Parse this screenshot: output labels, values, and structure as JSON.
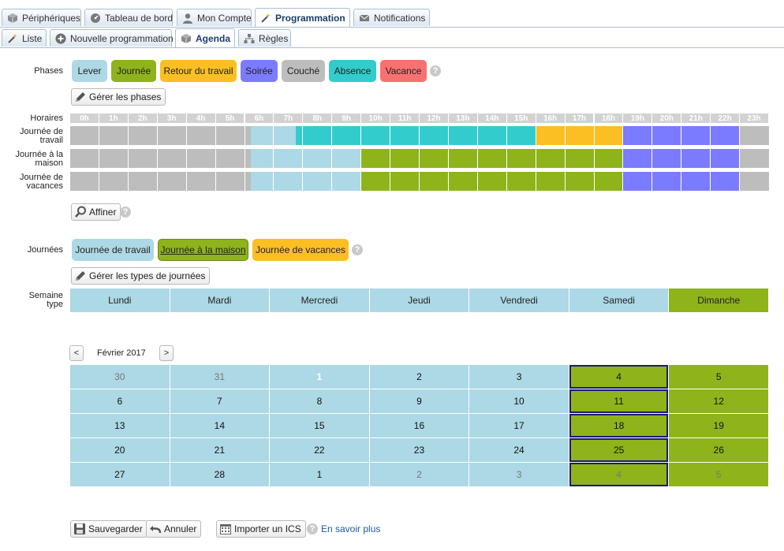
{
  "tabs_main": [
    {
      "label": "Périphériques",
      "icon": "cube-icon"
    },
    {
      "label": "Tableau de bord",
      "icon": "dashboard-icon"
    },
    {
      "label": "Mon Compte",
      "icon": "user-icon"
    },
    {
      "label": "Programmation",
      "icon": "magic-wand-icon",
      "active": true
    },
    {
      "label": "Notifications",
      "icon": "envelope-icon"
    }
  ],
  "tabs_sub": [
    {
      "label": "Liste",
      "icon": "magic-wand-icon"
    },
    {
      "label": "Nouvelle programmation",
      "icon": "plus-circle-icon"
    },
    {
      "label": "Agenda",
      "icon": "cube-icon",
      "active": true
    },
    {
      "label": "Règles",
      "icon": "sitemap-icon"
    }
  ],
  "phases": {
    "label": "Phases",
    "items": [
      {
        "label": "Lever",
        "color": "#add8e6"
      },
      {
        "label": "Journée",
        "color": "#8fb31a"
      },
      {
        "label": "Retour du travail",
        "color": "#fbbf24"
      },
      {
        "label": "Soirée",
        "color": "#7b7bff"
      },
      {
        "label": "Couché",
        "color": "#bdbdbd"
      },
      {
        "label": "Absence",
        "color": "#33cccc"
      },
      {
        "label": "Vacance",
        "color": "#f87171"
      }
    ],
    "manage_label": "Gérer les phases"
  },
  "schedule": {
    "hours_label": "Horaires",
    "hours": [
      "0h",
      "1h",
      "2h",
      "3h",
      "4h",
      "5h",
      "6h",
      "7h",
      "8h",
      "9h",
      "10h",
      "11h",
      "12h",
      "13h",
      "14h",
      "15h",
      "16h",
      "17h",
      "18h",
      "19h",
      "20h",
      "21h",
      "22h",
      "23h"
    ],
    "rows": [
      {
        "label": "Journée de travail",
        "segments": [
          {
            "from": 0,
            "to": 6.2,
            "phase": "Couché"
          },
          {
            "from": 6.2,
            "to": 7.75,
            "phase": "Lever"
          },
          {
            "from": 7.75,
            "to": 16,
            "phase": "Absence"
          },
          {
            "from": 16,
            "to": 19,
            "phase": "Retour du travail"
          },
          {
            "from": 19,
            "to": 23,
            "phase": "Soirée"
          },
          {
            "from": 23,
            "to": 24,
            "phase": "Couché"
          }
        ]
      },
      {
        "label": "Journée à la maison",
        "segments": [
          {
            "from": 0,
            "to": 6.2,
            "phase": "Couché"
          },
          {
            "from": 6.2,
            "to": 10,
            "phase": "Lever"
          },
          {
            "from": 10,
            "to": 19,
            "phase": "Journée"
          },
          {
            "from": 19,
            "to": 23,
            "phase": "Soirée"
          },
          {
            "from": 23,
            "to": 24,
            "phase": "Couché"
          }
        ]
      },
      {
        "label": "Journée de vacances",
        "segments": [
          {
            "from": 0,
            "to": 6.2,
            "phase": "Couché"
          },
          {
            "from": 6.2,
            "to": 10,
            "phase": "Lever"
          },
          {
            "from": 10,
            "to": 19,
            "phase": "Journée"
          },
          {
            "from": 19,
            "to": 23,
            "phase": "Soirée"
          },
          {
            "from": 23,
            "to": 24,
            "phase": "Couché"
          }
        ]
      }
    ],
    "refine_label": "Affiner"
  },
  "day_types": {
    "label": "Journées",
    "items": [
      {
        "label": "Journée de travail",
        "color": "#add8e6"
      },
      {
        "label": "Journée à la maison",
        "color": "#8fb31a",
        "selected": true
      },
      {
        "label": "Journée de vacances",
        "color": "#fbbf24"
      }
    ],
    "manage_label": "Gérer les types de journées"
  },
  "week": {
    "label": "Semaine type",
    "days": [
      {
        "label": "Lundi",
        "type": "Journée de travail"
      },
      {
        "label": "Mardi",
        "type": "Journée de travail"
      },
      {
        "label": "Mercredi",
        "type": "Journée de travail"
      },
      {
        "label": "Jeudi",
        "type": "Journée de travail"
      },
      {
        "label": "Vendredi",
        "type": "Journée de travail"
      },
      {
        "label": "Samedi",
        "type": "Journée de travail"
      },
      {
        "label": "Dimanche",
        "type": "Journée à la maison"
      }
    ]
  },
  "calendar": {
    "prev": "<",
    "next": ">",
    "month": "Février 2017",
    "weeks": [
      [
        {
          "d": "30",
          "out": true
        },
        {
          "d": "31",
          "out": true
        },
        {
          "d": "1",
          "today": true
        },
        {
          "d": "2"
        },
        {
          "d": "3"
        },
        {
          "d": "4",
          "sel": true
        },
        {
          "d": "5"
        }
      ],
      [
        {
          "d": "6"
        },
        {
          "d": "7"
        },
        {
          "d": "8"
        },
        {
          "d": "9"
        },
        {
          "d": "10"
        },
        {
          "d": "11",
          "sel": true
        },
        {
          "d": "12"
        }
      ],
      [
        {
          "d": "13"
        },
        {
          "d": "14"
        },
        {
          "d": "15"
        },
        {
          "d": "16"
        },
        {
          "d": "17"
        },
        {
          "d": "18",
          "sel": true
        },
        {
          "d": "19"
        }
      ],
      [
        {
          "d": "20"
        },
        {
          "d": "21"
        },
        {
          "d": "22"
        },
        {
          "d": "23"
        },
        {
          "d": "24"
        },
        {
          "d": "25",
          "sel": true
        },
        {
          "d": "26"
        }
      ],
      [
        {
          "d": "27"
        },
        {
          "d": "28"
        },
        {
          "d": "1"
        },
        {
          "d": "2",
          "out": true
        },
        {
          "d": "3",
          "out": true
        },
        {
          "d": "4",
          "sel": true,
          "out": true
        },
        {
          "d": "5",
          "out": true
        }
      ]
    ]
  },
  "footer": {
    "save": "Sauvegarder",
    "cancel": "Annuler",
    "import": "Importer un ICS",
    "learn_more": "En savoir plus"
  }
}
